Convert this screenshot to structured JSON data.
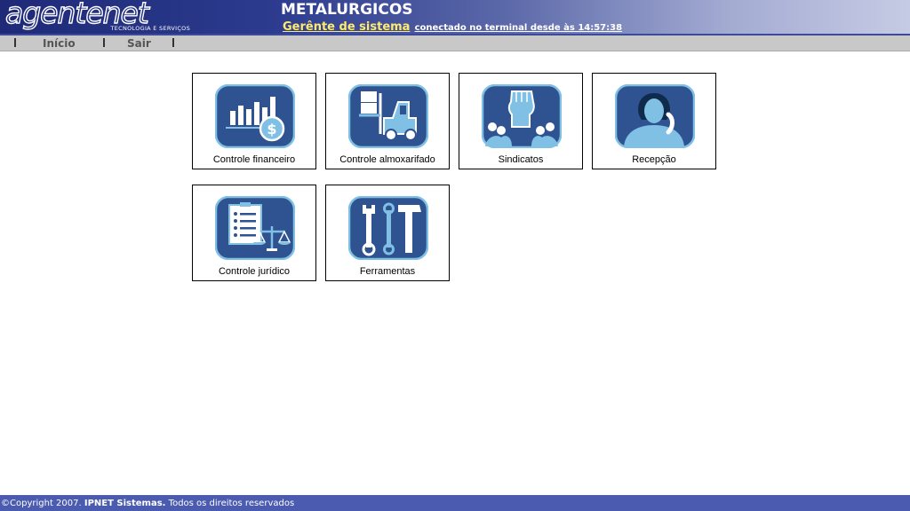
{
  "header": {
    "logo_text": "agentenet",
    "logo_tagline": "TECNOLOGIA E SERVIÇOS",
    "title": "METALURGICOS",
    "user_role": "Gerênte de sistema",
    "status": "conectado no terminal desde às 14:57:38"
  },
  "menu": {
    "items": [
      {
        "label": "Início"
      },
      {
        "label": "Sair"
      }
    ]
  },
  "tiles": [
    {
      "label": "Controle financeiro",
      "icon": "finance-chart-icon"
    },
    {
      "label": "Controle almoxarifado",
      "icon": "forklift-icon"
    },
    {
      "label": "Sindicatos",
      "icon": "raised-fist-icon"
    },
    {
      "label": "Recepção",
      "icon": "receptionist-phone-icon"
    },
    {
      "label": "Controle jurídico",
      "icon": "legal-scale-icon"
    },
    {
      "label": "Ferramentas",
      "icon": "tools-icon"
    }
  ],
  "footer": {
    "copyright_prefix": "©Copyright 2007. ",
    "company": "IPNET Sistemas.",
    "rights": " Todos os direitos reservados"
  },
  "colors": {
    "header_dark": "#1e2a78",
    "header_light": "#c6cbe4",
    "user_role": "#ffeb6a",
    "menubar": "#c8c8c8",
    "icon_bg": "#2e5390",
    "icon_border": "#7fc0e4",
    "footer": "#4a5bb0"
  }
}
